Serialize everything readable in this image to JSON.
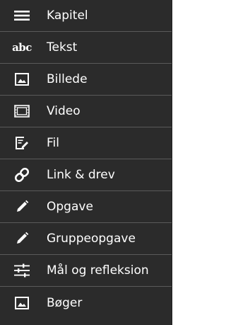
{
  "menu": {
    "items": [
      {
        "label": "Kapitel",
        "icon": "hamburger-icon"
      },
      {
        "label": "Tekst",
        "icon": "text-abc-icon",
        "icon_text": "abc"
      },
      {
        "label": "Billede",
        "icon": "image-icon"
      },
      {
        "label": "Video",
        "icon": "film-icon"
      },
      {
        "label": "Fil",
        "icon": "file-edit-icon"
      },
      {
        "label": "Link & drev",
        "icon": "link-icon"
      },
      {
        "label": "Opgave",
        "icon": "pencil-icon"
      },
      {
        "label": "Gruppeopgave",
        "icon": "pencil-icon"
      },
      {
        "label": "Mål og refleksion",
        "icon": "sliders-icon"
      },
      {
        "label": "Bøger",
        "icon": "image-icon"
      }
    ]
  },
  "colors": {
    "background": "#2b2b2b",
    "divider": "#5a5a5a",
    "text": "#ffffff"
  }
}
